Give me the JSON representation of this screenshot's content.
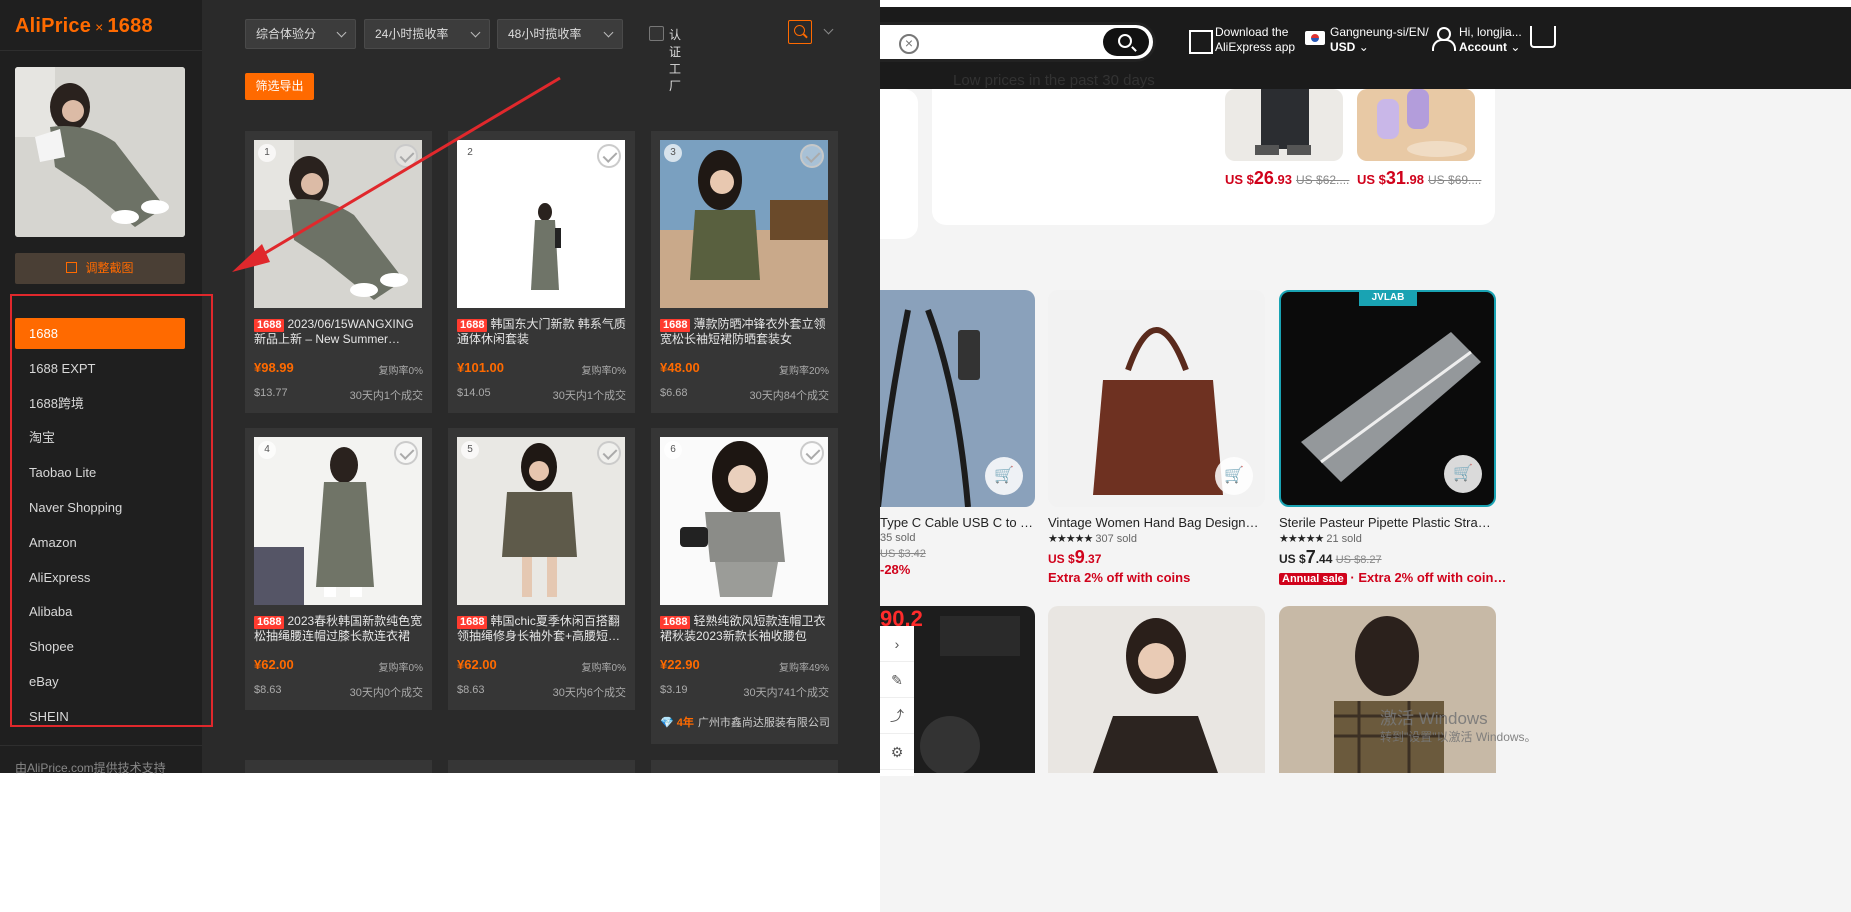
{
  "aliprice": {
    "logo_brand": "AliPrice",
    "logo_x": "×",
    "logo_site": "1688",
    "adjust_screenshot": "调整截图",
    "sources": [
      "1688",
      "1688 EXPT",
      "1688跨境",
      "淘宝",
      "Taobao Lite",
      "Naver Shopping",
      "Amazon",
      "AliExpress",
      "Alibaba",
      "Shopee",
      "eBay",
      "SHEIN"
    ],
    "footer": "由AliPrice.com提供技术支持",
    "filters": {
      "sort": "综合体验分",
      "rate24": "24小时揽收率",
      "rate48": "48小时揽收率",
      "factory": "认证工厂"
    },
    "export_button": "筛选导出",
    "accent": "#ff6a00"
  },
  "products": [
    {
      "num": "1",
      "tag": "1688",
      "title": "2023/06/15WANGXING 新品上新 – New Summer…",
      "price": "¥98.99",
      "repurchase": "复购率0%",
      "usd": "$13.77",
      "deals": "30天内1个成交"
    },
    {
      "num": "2",
      "tag": "1688",
      "title": "韩国东大门新款 韩系气质通体休闲套装",
      "price": "¥101.00",
      "repurchase": "复购率0%",
      "usd": "$14.05",
      "deals": "30天内1个成交"
    },
    {
      "num": "3",
      "tag": "1688",
      "title": "薄款防晒冲锋衣外套立领宽松长袖短裙防晒套装女2023…",
      "price": "¥48.00",
      "repurchase": "复购率20%",
      "usd": "$6.68",
      "deals": "30天内84个成交"
    },
    {
      "num": "4",
      "tag": "1688",
      "title": "2023春秋韩国新款纯色宽松抽绳腰连帽过膝长款连衣裙",
      "price": "¥62.00",
      "repurchase": "复购率0%",
      "usd": "$8.63",
      "deals": "30天内0个成交"
    },
    {
      "num": "5",
      "tag": "1688",
      "title": "韩国chic夏季休闲百搭翻领抽绳修身长袖外套+高腰短…",
      "price": "¥62.00",
      "repurchase": "复购率0%",
      "usd": "$8.63",
      "deals": "30天内6个成交"
    },
    {
      "num": "6",
      "tag": "1688",
      "title": "轻熟纯欲风短款连帽卫衣裙秋装2023新款长袖收腰包臀…",
      "price": "¥22.90",
      "repurchase": "复购率49%",
      "usd": "$3.19",
      "deals": "30天内741个成交",
      "supplier_years": "4年",
      "supplier": "广州市鑫尚达服装有限公司"
    }
  ],
  "aliexpress": {
    "app_line1": "Download the",
    "app_line2": "AliExpress app",
    "region_line1": "Gangneung-si/EN/",
    "region_line2": "USD",
    "account_line1": "Hi, longjia...",
    "account_line2": "Account",
    "low_prices": "Low prices in the past 30 days",
    "deal1_prefix": "US $",
    "deal1_big": "26",
    "deal1_cents": ".93",
    "deal1_old": "US $62....",
    "deal2_prefix": "US $",
    "deal2_big": "31",
    "deal2_cents": ".98",
    "deal2_old": "US $69....",
    "items": [
      {
        "title": "Type C Cable USB C to Typ…",
        "sold": "35 sold",
        "old": "US $3.42",
        "discount": "-28%"
      },
      {
        "title": "Vintage Women Hand Bag Designers…",
        "sold": "307 sold",
        "price_prefix": "US $",
        "price_big": "9",
        "price_cents": ".37",
        "extra": "Extra 2% off with coins"
      },
      {
        "title": "Sterile Pasteur Pipette Plastic Straw…",
        "sold": "21 sold",
        "price_prefix": "US $",
        "price_big": "7",
        "price_cents": ".44",
        "old": "US $8.27",
        "annual": "Annual sale",
        "extra": "· Extra 2% off with coin…",
        "badge": "JVLAB"
      }
    ],
    "promo_number": "90.2",
    "windows_line1": "激活 Windows",
    "windows_line2": "转到\"设置\"以激活 Windows。"
  }
}
